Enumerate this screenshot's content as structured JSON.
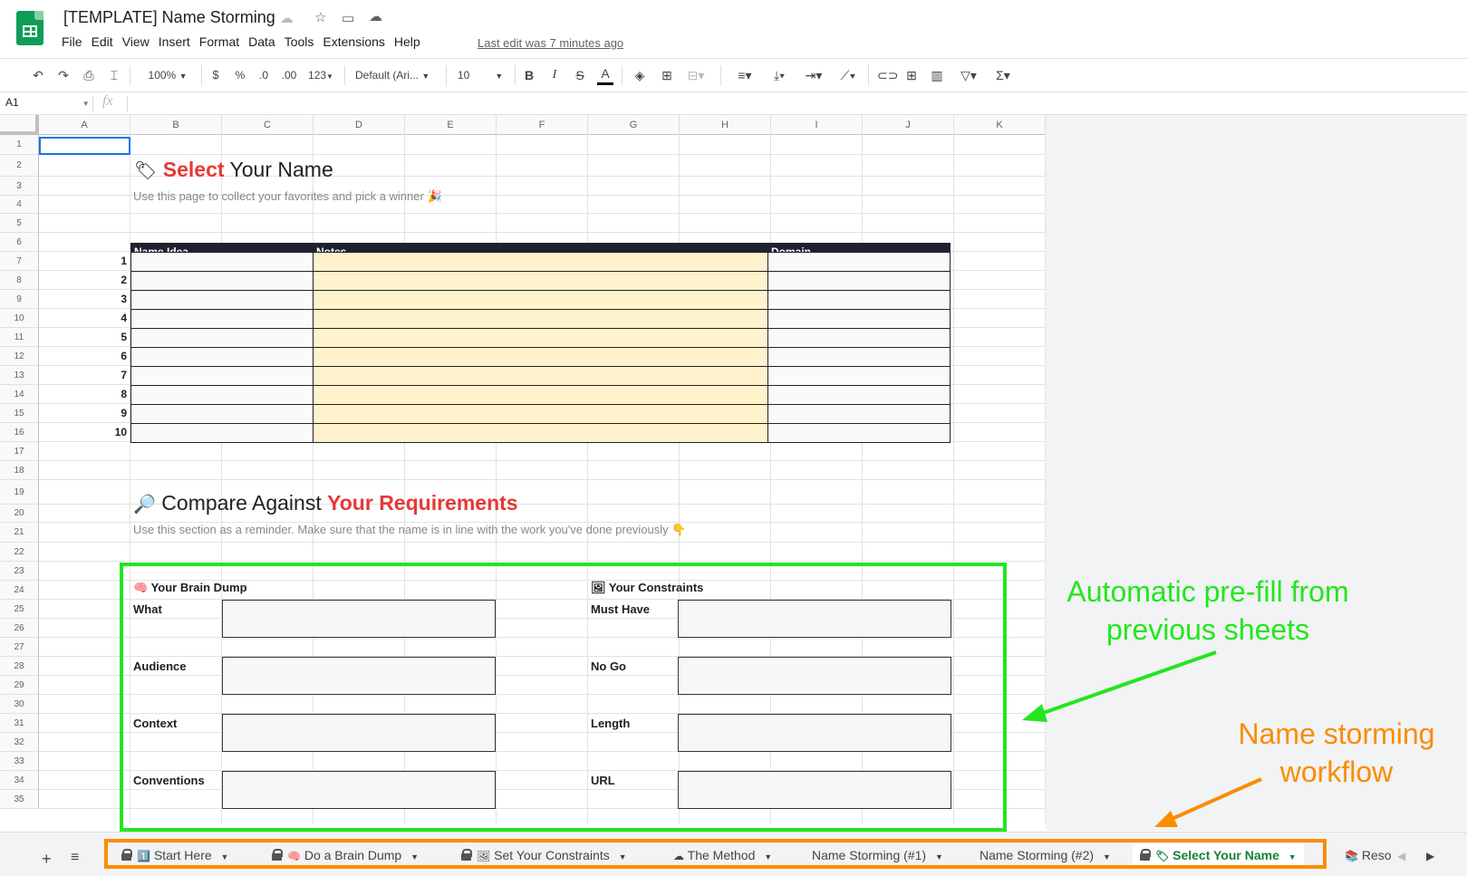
{
  "app": {
    "title": "[TEMPLATE] Name Storming",
    "title_emoji": "☁",
    "last_edit": "Last edit was 7 minutes ago"
  },
  "menu": [
    "File",
    "Edit",
    "View",
    "Insert",
    "Format",
    "Data",
    "Tools",
    "Extensions",
    "Help"
  ],
  "toolbar": {
    "zoom": "100%",
    "currency": "$",
    "percent": "%",
    "dec_decrease": ".0",
    "dec_increase": ".00",
    "more_formats": "123",
    "font": "Default (Ari...",
    "font_size": "10",
    "bold": "B",
    "italic": "I",
    "strike": "S",
    "text_color": "A"
  },
  "formula": {
    "cell_ref": "A1",
    "fx": "fx"
  },
  "columns": [
    "A",
    "B",
    "C",
    "D",
    "E",
    "F",
    "G",
    "H",
    "I",
    "J",
    "K"
  ],
  "rows": [
    "1",
    "2",
    "3",
    "4",
    "5",
    "6",
    "7",
    "8",
    "9",
    "10",
    "11",
    "12",
    "13",
    "14",
    "15",
    "16",
    "17",
    "18",
    "19",
    "20",
    "21",
    "22",
    "23",
    "24",
    "25",
    "26",
    "27",
    "28",
    "29",
    "30",
    "31",
    "32",
    "33",
    "34",
    "35"
  ],
  "select_section": {
    "emoji": "🏷",
    "title_red": "Select",
    "title_rest": " Your Name",
    "subtitle": "Use this page to collect your favorites and pick a winner",
    "subtitle_emoji": "🎉"
  },
  "table": {
    "headers": [
      "Name Idea",
      "Notes",
      "Domain"
    ],
    "numbers": [
      "1",
      "2",
      "3",
      "4",
      "5",
      "6",
      "7",
      "8",
      "9",
      "10"
    ],
    "colors": {
      "notes": "#fff2cc",
      "header": "#202030"
    }
  },
  "compare_section": {
    "emoji": "🔎",
    "title_rest": "Compare Against ",
    "title_red": "Your Requirements",
    "subtitle": "Use this section as a reminder. Make sure that the name is in line with the work you've done previously",
    "subtitle_emoji": "👇"
  },
  "brain_dump": {
    "emoji": "🧠",
    "title": "Your Brain Dump",
    "labels": [
      "What",
      "Audience",
      "Context",
      "Conventions"
    ]
  },
  "constraints": {
    "emoji": "🖼",
    "title": "Your Constraints",
    "labels": [
      "Must Have",
      "No Go",
      "Length",
      "URL"
    ]
  },
  "annotations": {
    "prefill": "Automatic pre-fill from previous sheets",
    "workflow": "Name storming workflow",
    "green": "#22e61e",
    "orange": "#fb8c00"
  },
  "tabs": [
    {
      "label": "Start Here",
      "emoji": "1️⃣",
      "locked": true
    },
    {
      "label": "Do a Brain Dump",
      "emoji": "🧠",
      "locked": true
    },
    {
      "label": "Set Your Constraints",
      "emoji": "🖼",
      "locked": true
    },
    {
      "label": "The Method",
      "emoji": "☁",
      "locked": false
    },
    {
      "label": "Name Storming (#1)",
      "emoji": "",
      "locked": false
    },
    {
      "label": "Name Storming (#2)",
      "emoji": "",
      "locked": false
    },
    {
      "label": "Select Your Name",
      "emoji": "🏷",
      "locked": true,
      "active": true
    },
    {
      "label": "Reso",
      "emoji": "📚",
      "locked": false
    }
  ]
}
